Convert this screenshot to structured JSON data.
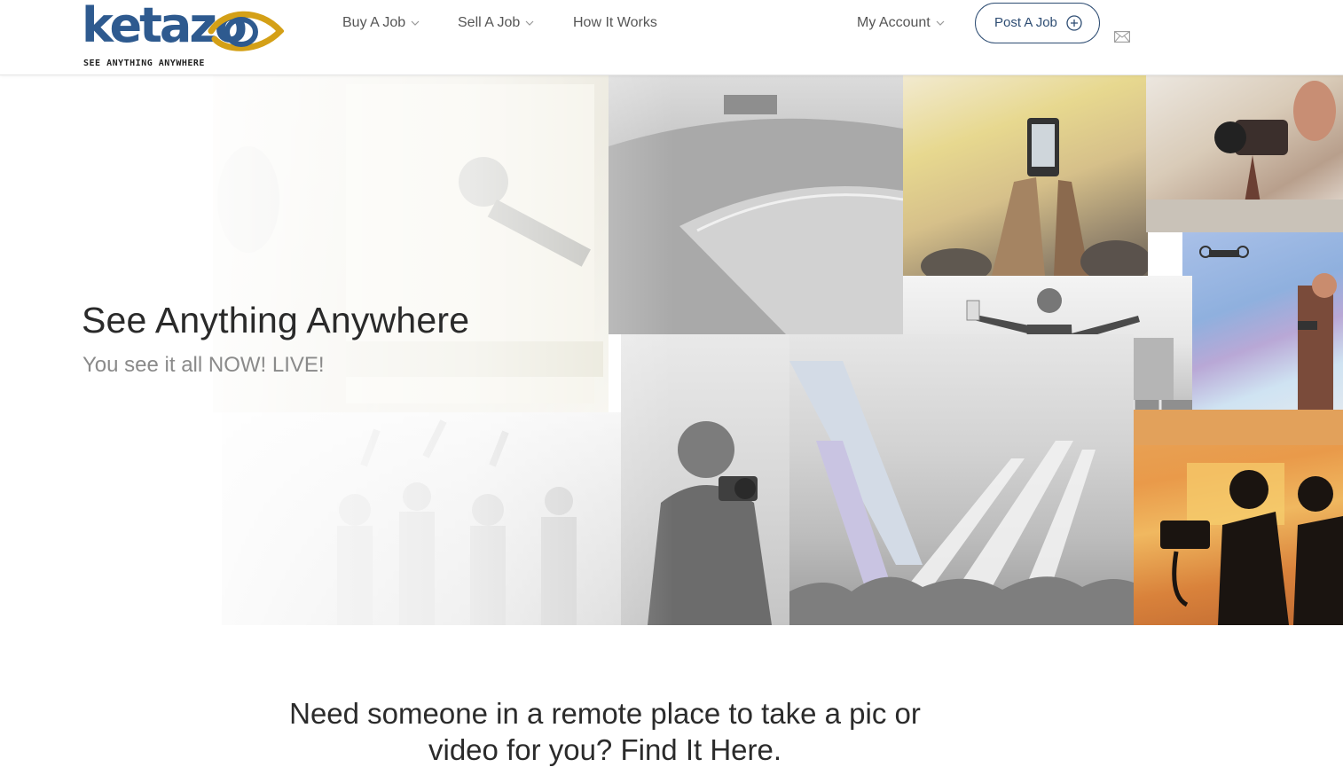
{
  "brand": {
    "name": "ketazo",
    "tagline": "SEE ANYTHING ANYWHERE",
    "colors": {
      "primary": "#2e5a8f",
      "accent": "#d4a017"
    }
  },
  "nav": {
    "buy": {
      "label": "Buy A Job",
      "icon": "chevron-down-icon"
    },
    "sell": {
      "label": "Sell A Job",
      "icon": "chevron-down-icon"
    },
    "how": {
      "label": "How It Works"
    },
    "account": {
      "label": "My Account",
      "icon": "chevron-down-icon"
    },
    "post": {
      "label": "Post A Job",
      "icon": "plus-circle-icon"
    },
    "mail": {
      "icon": "mail-icon"
    }
  },
  "hero": {
    "title": "See Anything Anywhere",
    "subtitle": "You see it all NOW! LIVE!"
  },
  "tagline": {
    "line1": "Need someone in a remote place to take a pic or",
    "line2": "video for you? Find It Here."
  }
}
